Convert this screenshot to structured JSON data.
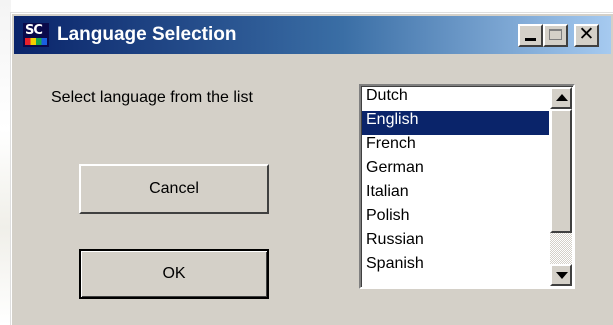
{
  "window": {
    "title": "Language Selection",
    "icon_name": "sc-app-icon",
    "icon_text": "SC"
  },
  "titlebar_buttons": {
    "minimize_icon": "minimize-icon",
    "maximize_icon": "maximize-icon",
    "close_icon": "close-icon",
    "close_glyph": "✕"
  },
  "prompt": "Select language from the list",
  "buttons": {
    "cancel_label": "Cancel",
    "ok_label": "OK"
  },
  "languages": {
    "items": [
      "Dutch",
      "English",
      "French",
      "German",
      "Italian",
      "Polish",
      "Russian",
      "Spanish"
    ],
    "selected": "English"
  },
  "colors": {
    "selection": "#0a246a",
    "face": "#d4d0c8"
  }
}
